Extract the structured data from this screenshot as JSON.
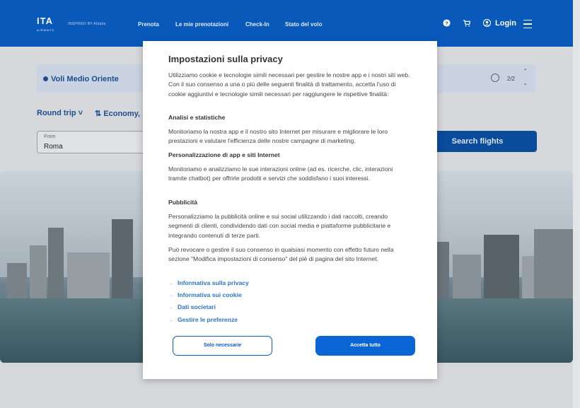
{
  "header": {
    "logo_text": "ITA",
    "logo_sub": "AIRWAYS",
    "inspired": "INSPIRED BY Alitalia",
    "nav": [
      "Prenota",
      "Le mie prenotazioni",
      "Check-In",
      "Stato del volo"
    ],
    "login": "Login"
  },
  "alert": {
    "title": "Voli Medio Oriente",
    "counter": "2/2"
  },
  "search": {
    "trip": "Round trip",
    "cabin": "Economy, 1",
    "from_label": "From",
    "from_value": "Roma",
    "button": "Search flights"
  },
  "modal": {
    "title": "Impostazioni sulla privacy",
    "intro": "Utilizziamo cookie e tecnologie simili necessari per gestire le nostre app e i nostri siti web. Con il suo consenso a una o più delle seguenti finalità di trattamento, accetta l'uso di cookie aggiuntivi e tecnologie simili necessari per raggiungere le rispettive finalità:",
    "sections": [
      {
        "heading": "Analisi e statistiche",
        "text": "Monitoriamo la nostra app e il nostro sito Internet per misurare e migliorare le loro prestazioni e valutare l'efficienza delle nostre campagne di marketing."
      },
      {
        "heading": "Personalizzazione di app e siti Internet",
        "text": "Monitoriamo e analizziamo le sue interazioni online (ad es. ricerche, clic, interazioni tramite chatbot) per offrirle prodotti e servizi che soddisfano i suoi interessi."
      },
      {
        "heading": "Pubblicità",
        "text": "Personalizziamo la pubblicità online e sui social utilizzando i dati raccolti, creando segmenti di clienti, condividendo dati con social media e piattaforme pubblicitarie e integrando contenuti di terze parti."
      }
    ],
    "revoke": "Può revocare o gestire il suo consenso in qualsiasi momento con effetto futuro nella sezione \"Modifica impostazioni di consenso\" del piè di pagina del sito Internet.",
    "links": [
      "Informativa sulla privacy",
      "Informativa sui cookie",
      "Dati societari",
      "Gestire le preferenze"
    ],
    "btn_necessary": "Solo necessarie",
    "btn_accept": "Accetta tutto"
  },
  "colors": {
    "brand": "#0a5bbf",
    "link": "#2d74c9"
  }
}
